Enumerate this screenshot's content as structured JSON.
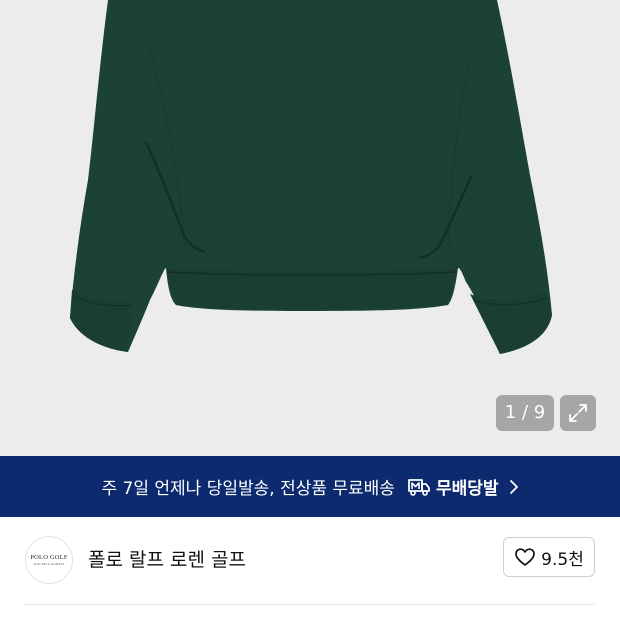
{
  "gallery": {
    "counter_current": "1",
    "counter_total": "9",
    "counter_text": "1 / 9",
    "background_color": "#ececec",
    "product_color": "#1c4236",
    "expand_icon": "expand-arrows-icon"
  },
  "banner": {
    "message": "주 7일 언제나 당일발송, 전상품 무료배송",
    "badge_label": "무배당발",
    "badge_icon": "delivery-truck-m-icon",
    "chevron_icon": "chevron-right-icon",
    "background_color": "#0d2a6e"
  },
  "brand": {
    "logo_line1": "POLO GOLF",
    "logo_line2": "RALPH LAUREN",
    "name": "폴로 랄프 로렌 골프"
  },
  "like": {
    "icon": "heart-outline-icon",
    "count": "9.5천"
  }
}
